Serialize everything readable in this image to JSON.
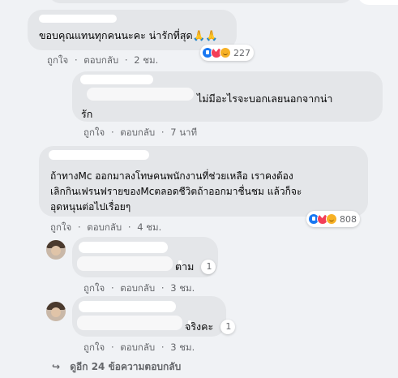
{
  "actions": {
    "like_label": "ถูกใจ",
    "reply_label": "ตอบกลับ",
    "separator": "·"
  },
  "comments": [
    {
      "text": "ขอบคุณแทนทุกคนนะคะ น่ารักที่สุด🙏🙏",
      "time": "2 ชม.",
      "reaction_count": "227"
    },
    {
      "text_line1": "ไม่มีอะไรจะบอกเลยนอกจากน่า",
      "text_line2": "รัก",
      "time": "7 นาที"
    },
    {
      "text_line1": "ถ้าทางMc ออกมาลงโทษคนพนักงานที่ช่วยเหลือ เราคงต้อง",
      "text_line2": "เลิกกินเฟรนฟรายของMcตลอดชีวิตถ้าออกมาชื่นชม แล้วก็จะ",
      "text_line3": "อุดหนุนต่อไปเรื่อยๆ",
      "time": "4 ชม.",
      "reaction_count": "808"
    },
    {
      "text": "ตาม",
      "time": "3 ชม.",
      "reaction_count": "1"
    },
    {
      "text": "จริงคะ",
      "time": "3 ชม.",
      "reaction_count": "1"
    }
  ],
  "more_replies": {
    "label": "ดูอีก 24 ข้อความตอบกลับ"
  },
  "colors": {
    "background": "#f0f2f5",
    "bubble": "#e4e6e9",
    "meta_text": "#65676b",
    "like_blue": "#1877f2",
    "love_red": "#f33e58",
    "care_yellow": "#f7b125"
  },
  "icons": {
    "like": "like-icon",
    "love": "love-icon",
    "care": "care-icon",
    "reply_arrow": "reply-arrow-icon"
  }
}
